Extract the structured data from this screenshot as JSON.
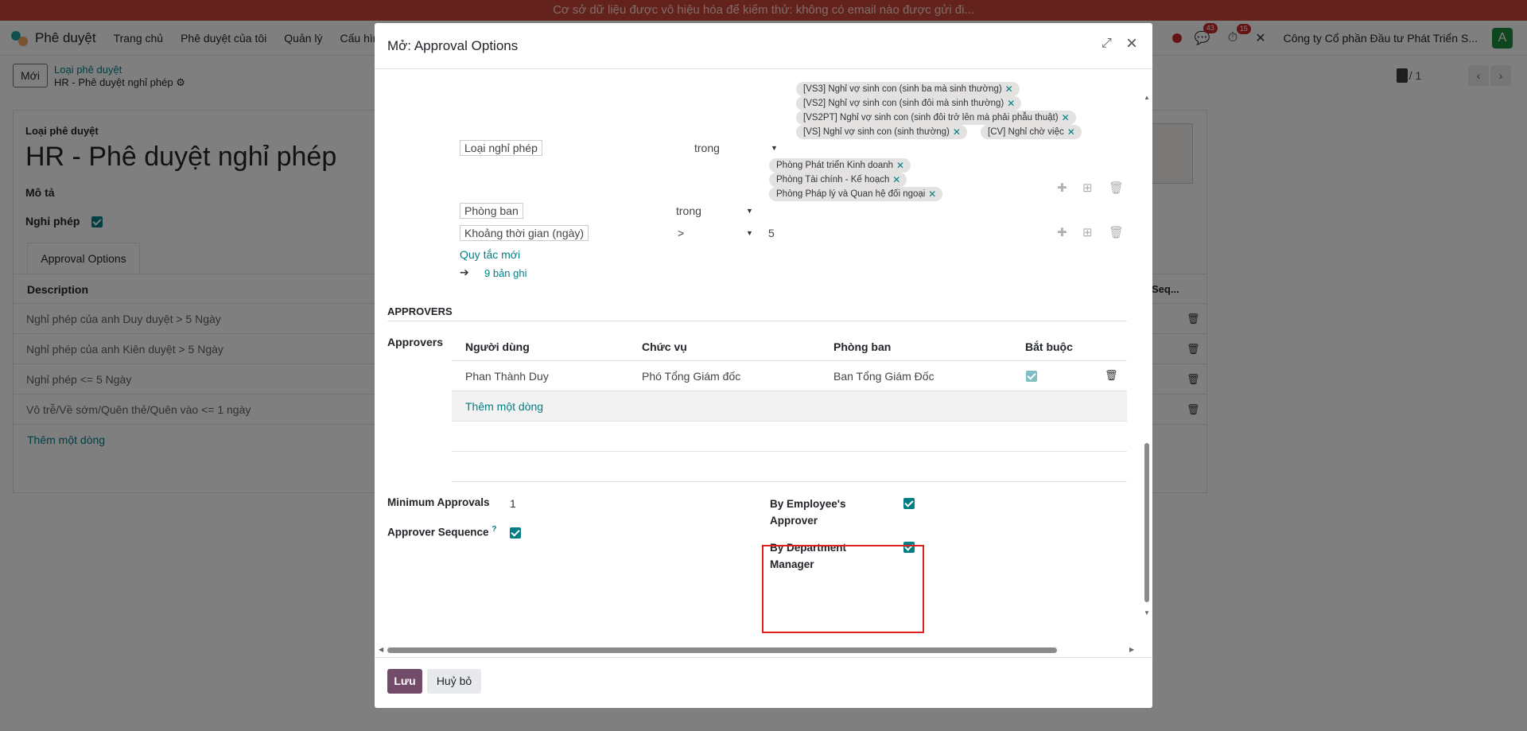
{
  "banner": {
    "text": "Cơ sở dữ liệu được vô hiệu hóa để kiểm thử: không có email nào được gửi đi..."
  },
  "navbar": {
    "app_name": "Phê duyệt",
    "menu": [
      "Trang chủ",
      "Phê duyệt của tôi",
      "Quản lý",
      "Cấu hìn"
    ],
    "messages_count": "43",
    "activities_count": "15",
    "company": "Công ty Cổ phần Đầu tư Phát Triển S...",
    "avatar_letter": "A"
  },
  "control_panel": {
    "new_label": "Mới",
    "breadcrumb_parent": "Loại phê duyệt",
    "breadcrumb_current": "HR - Phê duyệt nghỉ phép",
    "pager": "1 / 1"
  },
  "sheet": {
    "label": "Loại phê duyệt",
    "title": "HR - Phê duyệt nghỉ phép",
    "description_label": "Mô tả",
    "leave_label": "Nghỉ phép",
    "tab": "Approval Options",
    "column": "Description",
    "column2": "Seq...",
    "rows": [
      "Nghỉ phép của anh Duy duyệt > 5 Ngày",
      "Nghỉ phép của anh Kiên duyệt > 5 Ngày",
      "Nghỉ phép <= 5 Ngày",
      "Vô trễ/Về sớm/Quên thẻ/Quên vào <= 1 ngày"
    ],
    "add_line": "Thêm một dòng"
  },
  "modal": {
    "title": "Mở: Approval Options",
    "leave_type_tags": [
      "[VS3] Nghỉ vợ sinh con (sinh ba mà sinh thường)",
      "[VS2] Nghỉ vợ sinh con (sinh đôi mà sinh thường)",
      "[VS2PT] Nghỉ vợ sinh con (sinh đôi trở lên mà phải phẫu thuật)",
      "[VS] Nghỉ vợ sinh con (sinh thường)",
      "[CV] Nghỉ chờ việc"
    ],
    "rule1": {
      "field": "Loại nghỉ phép",
      "operator": "trong"
    },
    "department_tags": [
      "Phòng Phát triển Kinh doanh",
      "Phòng Tài chính - Kế hoạch",
      "Phòng Pháp lý và Quan hệ đối ngoại"
    ],
    "rule2": {
      "field": "Phòng ban",
      "operator": "trong"
    },
    "rule3": {
      "field": "Khoảng thời gian (ngày)",
      "operator": ">",
      "value": "5"
    },
    "new_rule": "Quy tắc mới",
    "records": "9 bản ghi",
    "approvers_section": "APPROVERS",
    "approvers_label": "Approvers",
    "approvers_columns": [
      "Người dùng",
      "Chức vụ",
      "Phòng ban",
      "Bắt buộc"
    ],
    "approvers_row": {
      "user": "Phan Thành Duy",
      "position": "Phó Tổng Giám đốc",
      "department": "Ban Tổng Giám Đốc"
    },
    "add_line": "Thêm một dòng",
    "min_approvals_label": "Minimum Approvals",
    "min_approvals_value": "1",
    "approver_sequence_label": "Approver Sequence",
    "approver_sequence_help": "?",
    "by_employee_approver": "By Employee's Approver",
    "by_department_manager": "By Department Manager",
    "save": "Lưu",
    "discard": "Huỷ bỏ"
  },
  "colors": {
    "accent": "#017e84",
    "primary": "#714b67",
    "banner": "#c8453b",
    "highlight": "#e02020"
  }
}
